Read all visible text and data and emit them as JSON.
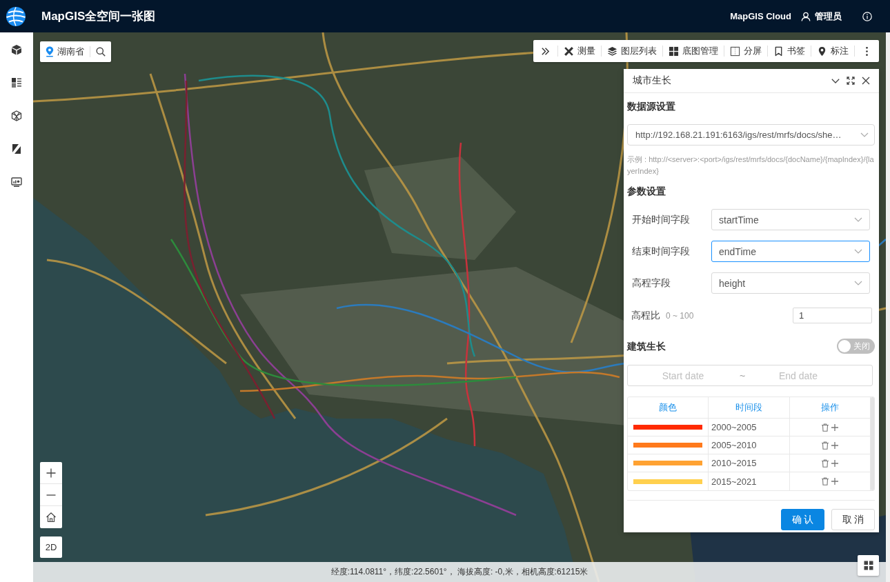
{
  "header": {
    "title": "MapGIS全空间一张图",
    "cloud_link": "MapGIS Cloud",
    "user": "管理员"
  },
  "sidebar": {
    "items": [
      {
        "kind": "cube"
      },
      {
        "kind": "list"
      },
      {
        "kind": "wireframe"
      },
      {
        "kind": "slant"
      },
      {
        "kind": "monitor"
      }
    ]
  },
  "region_search": {
    "value": "湖南省"
  },
  "toolbar": {
    "items": [
      {
        "kind": "collapse"
      },
      {
        "kind": "measure",
        "label": "测量"
      },
      {
        "kind": "layers",
        "label": "图层列表"
      },
      {
        "kind": "basemap",
        "label": "底图管理"
      },
      {
        "kind": "split",
        "label": "分屏"
      },
      {
        "kind": "bookmark",
        "label": "书签"
      },
      {
        "kind": "marker",
        "label": "标注"
      },
      {
        "kind": "more"
      }
    ]
  },
  "panel": {
    "title": "城市生长",
    "data_source": {
      "heading": "数据源设置",
      "value": "http://192.168.21.191:6163/igs/rest/mrfs/docs/she…",
      "hint": "示例 : http://<server>:<port>/igs/rest/mrfs/docs/{docName}/{mapIndex}/{layerIndex}"
    },
    "parameters": {
      "heading": "参数设置",
      "fields": [
        {
          "label": "开始时间字段",
          "value": "startTime",
          "focused": false
        },
        {
          "label": "结束时间字段",
          "value": "endTime",
          "focused": true
        },
        {
          "label": "高程字段",
          "value": "height",
          "focused": false
        }
      ],
      "elevation_ratio": {
        "label": "高程比",
        "range": "0 ~ 100",
        "value": "1"
      }
    },
    "building_growth": {
      "heading": "建筑生长",
      "toggle": {
        "on": false,
        "label": "关闭"
      },
      "date_range": {
        "start_placeholder": "Start date",
        "separator": "~",
        "end_placeholder": "End date"
      },
      "table": {
        "columns": [
          "颜色",
          "时间段",
          "操作"
        ],
        "rows": [
          {
            "color": "#ff2a00",
            "period": "2000~2005"
          },
          {
            "color": "#ff7a1c",
            "period": "2005~2010"
          },
          {
            "color": "#ffa232",
            "period": "2010~2015"
          },
          {
            "color": "#ffd04e",
            "period": "2015~2021"
          }
        ]
      }
    },
    "buttons": [
      {
        "label": "确 认",
        "kind": "primary"
      },
      {
        "label": "取 消",
        "kind": "default"
      }
    ]
  },
  "map_controls": {
    "view_mode": "2D"
  },
  "status_bar": "经度:114.0811°，纬度:22.5601°， 海拔高度: -0,米，相机高度:61215米"
}
